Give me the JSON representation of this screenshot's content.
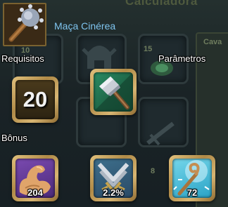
{
  "background": {
    "title": "Calculadora",
    "side_tab": "Cava",
    "slot_numbers": [
      "10",
      "15",
      "8"
    ]
  },
  "weapon": {
    "name": "Maça Cinérea",
    "icon": "spiked-mace-icon"
  },
  "requirements": {
    "label": "Requisitos",
    "level_value": "20",
    "skill_icon": "hammer-skill-icon"
  },
  "parameters": {
    "label": "Parâmetros"
  },
  "bonus": {
    "label": "Bônus",
    "items": [
      {
        "icon": "muscle-strength-icon",
        "value": "204"
      },
      {
        "icon": "shield-swords-icon",
        "value": "2.2%"
      },
      {
        "icon": "staff-magic-icon",
        "value": "72"
      }
    ]
  },
  "colors": {
    "weapon_name": "#7fc4ef",
    "slot_border": "#c9a45d",
    "hammer_bg": "#1f6a4a"
  }
}
